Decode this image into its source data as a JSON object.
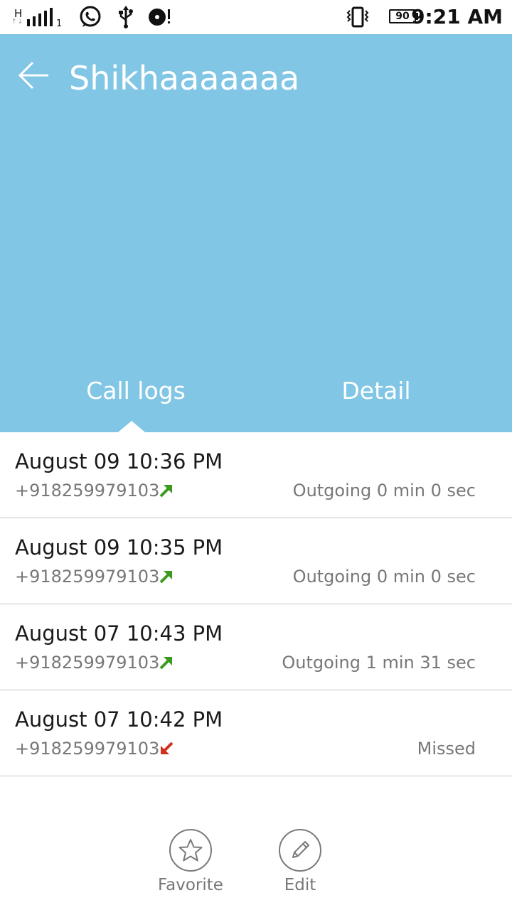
{
  "status_bar": {
    "network_type": "H",
    "network_arrows": "↑↓",
    "sim_index": "1",
    "icons": [
      "signal-icon",
      "whatsapp-icon",
      "usb-icon",
      "music-alert-icon",
      "vibrate-icon",
      "battery-icon"
    ],
    "battery_level": "90",
    "time": "9:21 AM"
  },
  "header": {
    "contact_name": "Shikhaaaaaaa",
    "background_color": "#82c6e6",
    "tabs": [
      {
        "label": "Call logs",
        "selected": true
      },
      {
        "label": "Detail",
        "selected": false
      }
    ]
  },
  "call_logs": [
    {
      "datetime": "August 09 10:36 PM",
      "number": "+918259979103",
      "direction": "outgoing",
      "status": "Outgoing 0 min 0 sec"
    },
    {
      "datetime": "August 09 10:35 PM",
      "number": "+918259979103",
      "direction": "outgoing",
      "status": "Outgoing 0 min 0 sec"
    },
    {
      "datetime": "August 07 10:43 PM",
      "number": "+918259979103",
      "direction": "outgoing",
      "status": "Outgoing 1 min 31 sec"
    },
    {
      "datetime": "August 07 10:42 PM",
      "number": "+918259979103",
      "direction": "missed",
      "status": "Missed"
    }
  ],
  "colors": {
    "outgoing": "#3a9a1e",
    "missed": "#d0301e"
  },
  "actions": [
    {
      "label": "Favorite",
      "icon": "star-icon"
    },
    {
      "label": "Edit",
      "icon": "pencil-icon"
    }
  ]
}
